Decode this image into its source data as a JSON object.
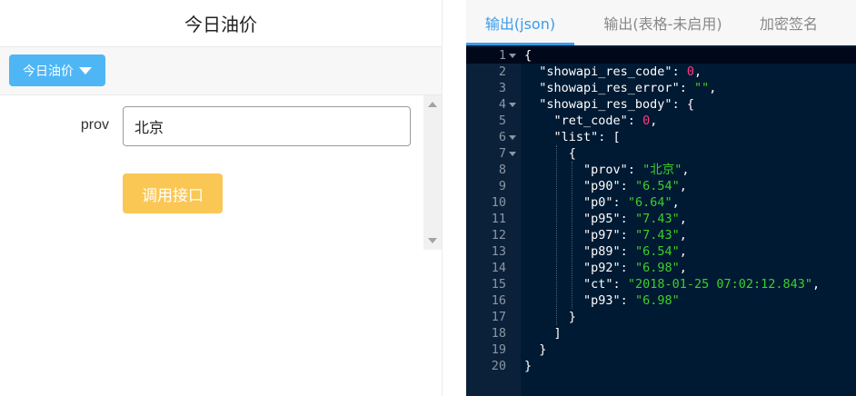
{
  "left": {
    "title": "今日油价",
    "api_dropdown_label": "今日油价",
    "form": {
      "prov_label": "prov",
      "prov_value": "北京"
    },
    "call_button": "调用接口"
  },
  "right": {
    "tabs": [
      {
        "label": "输出(json)",
        "active": true
      },
      {
        "label": "输出(表格-未启用)",
        "active": false
      },
      {
        "label": "加密签名",
        "active": false
      }
    ],
    "lines": [
      {
        "n": "1",
        "fold": true
      },
      {
        "n": "2"
      },
      {
        "n": "3"
      },
      {
        "n": "4",
        "fold": true
      },
      {
        "n": "5"
      },
      {
        "n": "6",
        "fold": true
      },
      {
        "n": "7",
        "fold": true
      },
      {
        "n": "8"
      },
      {
        "n": "9"
      },
      {
        "n": "10"
      },
      {
        "n": "11"
      },
      {
        "n": "12"
      },
      {
        "n": "13"
      },
      {
        "n": "14"
      },
      {
        "n": "15"
      },
      {
        "n": "16"
      },
      {
        "n": "17"
      },
      {
        "n": "18"
      },
      {
        "n": "19"
      },
      {
        "n": "20"
      }
    ],
    "json": {
      "l1": "{",
      "k_code": "\"showapi_res_code\"",
      "v_code": "0",
      "k_error": "\"showapi_res_error\"",
      "v_error": "\"\"",
      "k_body": "\"showapi_res_body\"",
      "k_ret": "\"ret_code\"",
      "v_ret": "0",
      "k_list": "\"list\"",
      "l7": "{",
      "k_prov": "\"prov\"",
      "v_prov": "\"北京\"",
      "k_p90": "\"p90\"",
      "v_p90": "\"6.54\"",
      "k_p0": "\"p0\"",
      "v_p0": "\"6.64\"",
      "k_p95": "\"p95\"",
      "v_p95": "\"7.43\"",
      "k_p97": "\"p97\"",
      "v_p97": "\"7.43\"",
      "k_p89": "\"p89\"",
      "v_p89": "\"6.54\"",
      "k_p92": "\"p92\"",
      "v_p92": "\"6.98\"",
      "k_ct": "\"ct\"",
      "v_ct": "\"2018-01-25 07:02:12.843\"",
      "k_p93": "\"p93\"",
      "v_p93": "\"6.98\"",
      "l17": "}",
      "l18": "]",
      "l19": "}",
      "l20": "}"
    }
  },
  "colors": {
    "accent_blue": "#4fb6f5",
    "call_yellow": "#fbc754",
    "editor_bg": "#001a33",
    "string_green": "#3ecf2a",
    "number_pink": "#ff3d7f"
  },
  "icons": {
    "dropdown": "caret-down-icon",
    "fold": "fold-arrow-icon"
  }
}
